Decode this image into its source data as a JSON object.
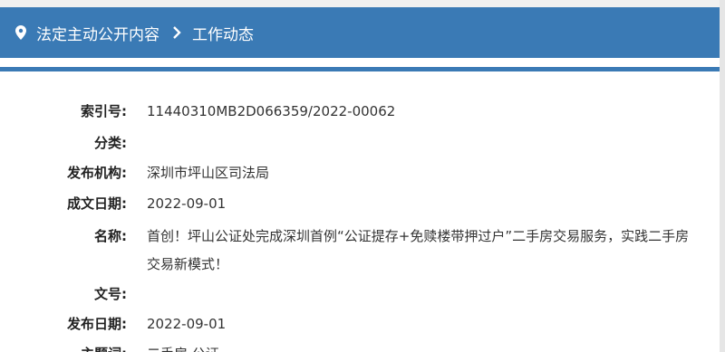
{
  "breadcrumb": {
    "items": [
      "法定主动公开内容",
      "工作动态"
    ]
  },
  "details": [
    {
      "label": "索引号:",
      "value": "11440310MB2D066359/2022-00062"
    },
    {
      "label": "分类:",
      "value": ""
    },
    {
      "label": "发布机构:",
      "value": "深圳市坪山区司法局"
    },
    {
      "label": "成文日期:",
      "value": "2022-09-01"
    },
    {
      "label": "名称:",
      "value": "首创！坪山公证处完成深圳首例“公证提存+免赎楼带押过户”二手房交易服务，实践二手房交易新模式！"
    },
    {
      "label": "文号:",
      "value": ""
    },
    {
      "label": "发布日期:",
      "value": "2022-09-01"
    },
    {
      "label": "主题词:",
      "value": "二手房,公证"
    }
  ],
  "colors": {
    "accent": "#3a7ab5"
  },
  "icons": {
    "location": "map-pin-icon",
    "separator": "chevron-right-icon"
  }
}
